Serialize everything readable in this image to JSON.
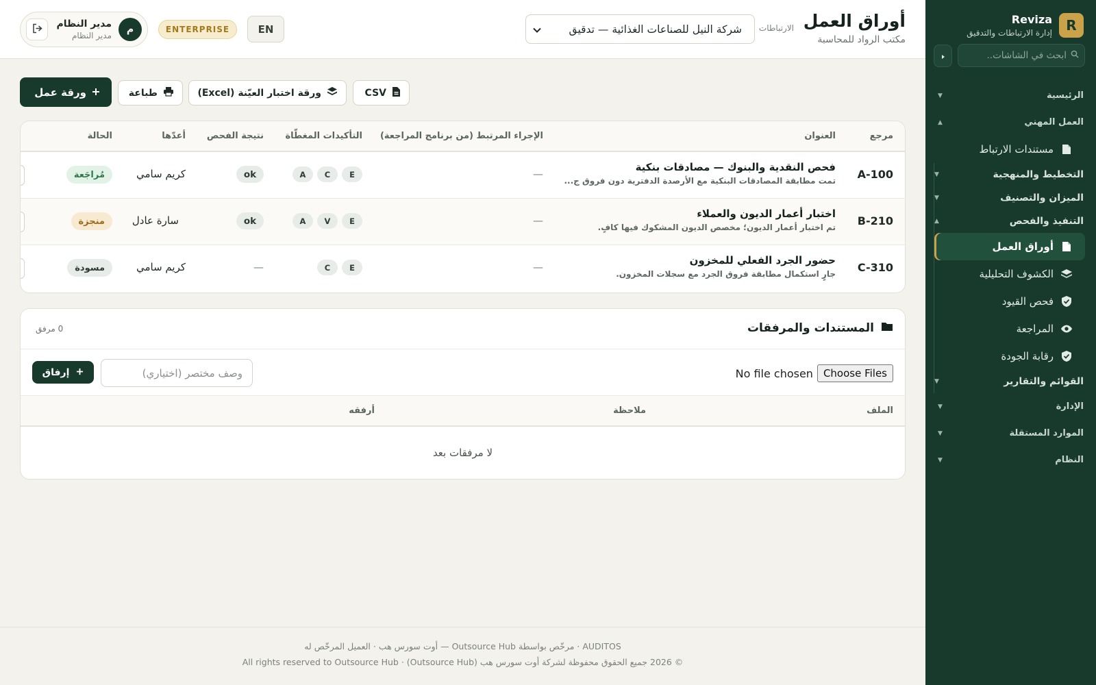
{
  "brand": {
    "mark": "R",
    "name": "Reviza",
    "subtitle": "إدارة الارتباطات والتدقيق"
  },
  "sidebar": {
    "search_placeholder": "ابحث في الشاشات..",
    "sections": [
      {
        "label": "الرئيسية"
      },
      {
        "label": "العمل المهني"
      },
      {
        "label": "مستندات الارتباط"
      },
      {
        "label": "التخطيط والمنهجية"
      },
      {
        "label": "الميزان والتصنيف"
      },
      {
        "label": "التنفيذ والفحص"
      },
      {
        "label": "أوراق العمل"
      },
      {
        "label": "الكشوف التحليلية"
      },
      {
        "label": "فحص القيود"
      },
      {
        "label": "المراجعة"
      },
      {
        "label": "رقابة الجودة"
      },
      {
        "label": "القوائم والتقارير"
      },
      {
        "label": "الإدارة"
      },
      {
        "label": "الموارد المستقلة"
      },
      {
        "label": "النظام"
      }
    ]
  },
  "header": {
    "title": "أوراق العمل",
    "subtitle": "مكتب الرواد للمحاسبة",
    "engagement_label": "الارتباطات",
    "engagement_value": "شركة النيل للصناعات الغذائية — تدقيق",
    "lang": "EN",
    "plan_badge": "ENTERPRISE",
    "user": {
      "initial": "م",
      "name": "مدير النظام",
      "role": "مدير النظام"
    }
  },
  "actions": {
    "new_workpaper": "ورقة عمل",
    "print": "طباعة",
    "sample_sheet": "ورقة اختبار العيّنة (Excel)",
    "csv": "CSV"
  },
  "table": {
    "columns": [
      "مرجع",
      "العنوان",
      "الإجراء المرتبط (من برنامج المراجعة)",
      "التأكيدات المغطّاة",
      "نتيجة الفحص",
      "أعدّها",
      "الحالة"
    ],
    "rows": [
      {
        "ref": "A-100",
        "title": "فحص النقدية والبنوك — مصادقات بنكية",
        "desc": "تمت مطابقة المصادقات البنكية مع الأرصدة الدفترية دون فروق ج...",
        "procedure": "—",
        "assertions": [
          "E",
          "C",
          "A"
        ],
        "result": "ok",
        "preparer": "كريم سامي",
        "status": "مُراجَعة"
      },
      {
        "ref": "B-210",
        "title": "اختبار أعمار الديون والعملاء",
        "desc": "تم اختبار أعمار الديون؛ مخصص الديون المشكوك فيها كافٍ.",
        "procedure": "—",
        "assertions": [
          "E",
          "V",
          "A"
        ],
        "result": "ok",
        "preparer": "سارة عادل",
        "status": "منجزة"
      },
      {
        "ref": "C-310",
        "title": "حضور الجرد الفعلي للمخزون",
        "desc": "جارٍ استكمال مطابقة فروق الجرد مع سجلات المخزون.",
        "procedure": "—",
        "assertions": [
          "E",
          "C"
        ],
        "result": "—",
        "preparer": "كريم سامي",
        "status": "مسودة"
      }
    ]
  },
  "documents": {
    "title": "المستندات والمرفقات",
    "count": "0 مرفق",
    "file_button": "Choose Files",
    "file_status": "No file chosen",
    "note_placeholder": "وصف مختصر (اختياري)",
    "attach": "إرفاق",
    "columns": [
      "الملف",
      "ملاحظة",
      "أرفقه"
    ],
    "empty": "لا مرفقات بعد"
  },
  "footer": {
    "line1": "AUDITOS · مرخّص بواسطة Outsource Hub — أوت سورس هب · العميل المرخّص له",
    "line2": "© 2026 جميع الحقوق محفوظة لشركة أوت سورس هب (Outsource Hub) · All rights reserved to Outsource Hub"
  },
  "colors": {
    "sidebar_bg": "#173a2d",
    "accent_gold": "#c9a24a",
    "page_bg": "#f4f2ec",
    "primary_button": "#173a2d"
  },
  "icons": [
    "search-icon",
    "chevron-right-icon",
    "document-icon",
    "layers-icon",
    "shield-check-icon",
    "eye-icon",
    "plus-icon",
    "printer-icon",
    "file-csv-icon",
    "folder-icon",
    "logout-icon",
    "chevron-down-icon"
  ]
}
